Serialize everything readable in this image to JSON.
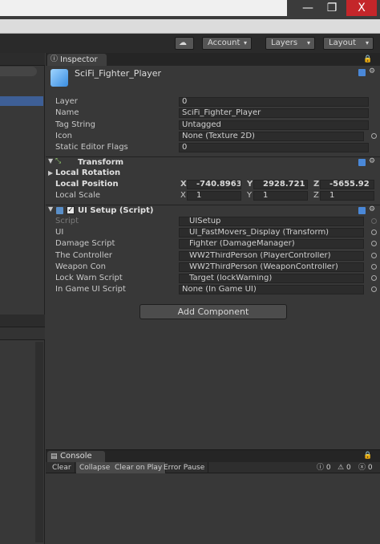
{
  "window": {
    "minimize": "—",
    "maximize": "❐",
    "close": "X"
  },
  "toolbar": {
    "account": "Account",
    "layers": "Layers",
    "layout": "Layout"
  },
  "inspector": {
    "tab": "Inspector",
    "object_name": "SciFi_Fighter_Player",
    "fields": [
      {
        "label": "Layer",
        "value": "0"
      },
      {
        "label": "Name",
        "value": "SciFi_Fighter_Player"
      },
      {
        "label": "Tag String",
        "value": "Untagged"
      },
      {
        "label": "Icon",
        "value": "None (Texture 2D)"
      },
      {
        "label": "Static Editor Flags",
        "value": "0"
      }
    ],
    "transform": {
      "title": "Transform",
      "rotation_label": "Local Rotation",
      "position_label": "Local Position",
      "scale_label": "Local Scale",
      "position": {
        "x": "-740.8963",
        "y": "2928.721",
        "z": "-5655.92"
      },
      "scale": {
        "x": "1",
        "y": "1",
        "z": "1"
      },
      "axes": {
        "x": "X",
        "y": "Y",
        "z": "Z"
      }
    },
    "ui_setup": {
      "title": "UI Setup (Script)",
      "fields": [
        {
          "label": "Script",
          "value": "UISetup"
        },
        {
          "label": "UI",
          "value": "UI_FastMovers_Display (Transform)"
        },
        {
          "label": "Damage Script",
          "value": "Fighter (DamageManager)"
        },
        {
          "label": "The Controller",
          "value": "WW2ThirdPerson (PlayerController)"
        },
        {
          "label": "Weapon Con",
          "value": "WW2ThirdPerson (WeaponController)"
        },
        {
          "label": "Lock Warn Script",
          "value": "Target (lockWarning)"
        },
        {
          "label": "In Game UI Script",
          "value": "None (In Game UI)"
        }
      ]
    },
    "add_component": "Add Component"
  },
  "console": {
    "tab": "Console",
    "buttons": [
      "Clear",
      "Collapse",
      "Clear on Play",
      "Error Pause"
    ],
    "counts": {
      "info": "0",
      "warn": "0",
      "error": "0"
    }
  }
}
